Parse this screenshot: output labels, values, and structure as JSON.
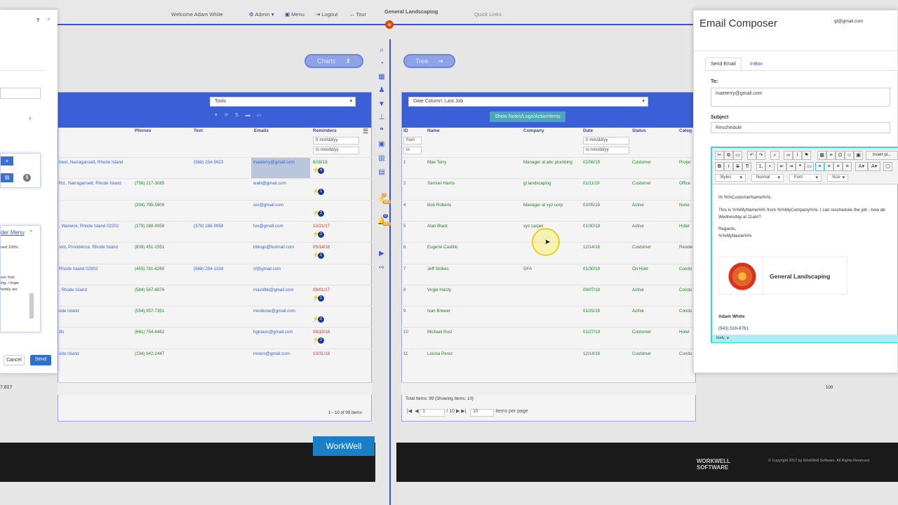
{
  "topbar": {
    "welcome": "Welcome  Adam White",
    "admin": "Admin",
    "menu": "Menu",
    "logout": "Logout",
    "tour": "Tour",
    "brand": "General Landscaping",
    "quick_links": "Quick Links"
  },
  "nav": {
    "charts": "Charts",
    "tree": "Tree"
  },
  "left_dialog": {
    "help": "?",
    "close": "×",
    "help2": "?",
    "plus": "+",
    "dollar": "$",
    "header_menu": "der Menu",
    "text_lines": [
      "ned 100%",
      "",
      "",
      "om York",
      "ing. I hope",
      "family are"
    ],
    "cancel": "Cancel",
    "send": "Send",
    "footer_num": "7,817"
  },
  "left_grid": {
    "tools": "Tools",
    "columns": [
      "Phones",
      "Text",
      "Emails",
      "Reminders"
    ],
    "filter_from": "fr mm/dd/yy",
    "filter_to": "to mm/dd/yy",
    "rows": [
      {
        "addr": "treet, Narragansett, Rhode Island",
        "phone": "",
        "text": "(568) 254-5623",
        "email": "maeterry@gmail.com",
        "rem": "6/28/19",
        "rem_color": "green",
        "badge": "4"
      },
      {
        "addr": "Rd., Narragansett, Rhode Island",
        "phone": "(756) 217-3085",
        "text": "",
        "email": "walit@gmail.com",
        "rem": "",
        "rem_color": "",
        "badge": "1"
      },
      {
        "addr": "",
        "phone": "(294) 795-5909",
        "text": "",
        "email": "ser@gmail.com",
        "rem": "",
        "rem_color": "",
        "badge": "2"
      },
      {
        "addr": ", Warwick, Rhode Island 02202",
        "phone": "(379) 288-9958",
        "text": "(379) 288-9958",
        "email": "fuv@gmail.com",
        "rem": "10/21/17",
        "rem_color": "red",
        "badge": "2"
      },
      {
        "addr": "stol, Providence, Rhode Island",
        "phone": "(839) 451-1551",
        "text": "",
        "email": "bbingo@hotmail.com",
        "rem": "05/14/18",
        "rem_color": "red",
        "badge": "1"
      },
      {
        "addr": "Rhode Island 02903",
        "phone": "(455) 781-6260",
        "text": "(568) 254-1234",
        "email": "cf@gmail.com",
        "rem": "",
        "rem_color": "",
        "badge": ""
      },
      {
        "addr": ", Rhode Island",
        "phone": "(584) 567-6876",
        "text": "",
        "email": "mavolbit@gmail.com",
        "rem": "09/01/17",
        "rem_color": "red",
        "badge": "1"
      },
      {
        "addr": "ode Island",
        "phone": "(554) 957-7351",
        "text": "",
        "email": "mesbone@gmail.com",
        "rem": "",
        "rem_color": "",
        "badge": "2"
      },
      {
        "addr": "ills",
        "phone": "(661) 754-8462",
        "text": "",
        "email": "bgmaec@gmail.com",
        "rem": "09/10/18",
        "rem_color": "red",
        "badge": "2"
      },
      {
        "addr": "ode Island",
        "phone": "(234) 642-2447",
        "text": "",
        "email": "moero@gmail.com",
        "rem": "10/31/18",
        "rem_color": "red",
        "badge": ""
      }
    ],
    "pager": "1 - 10 of 99 items"
  },
  "right_grid": {
    "date_column": "Date Column: Last Job",
    "show_notes": "Show Notes/Logs/ActionItems",
    "columns": [
      "ID",
      "Name",
      "Company",
      "Date",
      "Status",
      "Categ"
    ],
    "filter_from": "from",
    "filter_to": "to",
    "date_from": "fr mm/dd/yy",
    "date_to": "to mm/dd/yy",
    "rows": [
      {
        "id": "1",
        "name": "Mae Terry",
        "company": "Manager at abc plumbing",
        "date": "02/06/19",
        "status": "Customer",
        "cat": "Prope"
      },
      {
        "id": "2",
        "name": "Samuel Harris",
        "company": "gl landscaping",
        "date": "01/11/19",
        "status": "Customer",
        "cat": "Office"
      },
      {
        "id": "4",
        "name": "Bob Roberts",
        "company": "Manager at xyz corp",
        "date": "02/05/19",
        "status": "Active",
        "cat": "None"
      },
      {
        "id": "5",
        "name": "Alan Black",
        "company": "xyz carpet",
        "date": "01/30/19",
        "status": "Active",
        "cat": "Hotel"
      },
      {
        "id": "6",
        "name": "Eugene Castillo",
        "company": "",
        "date": "12/14/18",
        "status": "Customer",
        "cat": "Reside"
      },
      {
        "id": "7",
        "name": "Jeff Stokes",
        "company": "GFA",
        "date": "01/30/19",
        "status": "On Hold",
        "cat": "Condo"
      },
      {
        "id": "8",
        "name": "Virgie Hardy",
        "company": "",
        "date": "09/07/18",
        "status": "Active",
        "cat": "Condo"
      },
      {
        "id": "9",
        "name": "Ivan Brewer",
        "company": "",
        "date": "01/25/19",
        "status": "Active",
        "cat": "Condo"
      },
      {
        "id": "10",
        "name": "Michael Ruiz",
        "company": "",
        "date": "01/27/19",
        "status": "Customer",
        "cat": "Hotel"
      },
      {
        "id": "11",
        "name": "Louisa Perez",
        "company": "",
        "date": "12/14/18",
        "status": "Customer",
        "cat": "Condo"
      }
    ],
    "footer_num": "109",
    "total": "Total Items: 99 (Showing Items: 10)",
    "page": "1",
    "of_pages": "/ 10",
    "per_page": "10",
    "per_page_label": "items per page"
  },
  "sidebar_badges": {
    "a": "2",
    "b": "163",
    "c": "0",
    "d": "261"
  },
  "email_composer": {
    "title": "Email Composer",
    "account": "gl@gmail.com",
    "tab_send": "Send Email",
    "tab_inbox": "InBox",
    "to_label": "To:",
    "to_value": "maeterry@gmail.com",
    "subject_label": "Subject",
    "subject_value": "Reschedule",
    "insert_placeholder": "Insert pl...",
    "styles": "Styles",
    "normal": "Normal",
    "font": "Font",
    "size": "Size",
    "body_hi": "Hi %%CustomerName%%,",
    "body_line1": "This is %%MyName%% from %%MyCompany%%. I can reschedule the job - how ab",
    "body_line2": "Wednesday at 11am?",
    "body_regards": "Regards,",
    "body_name": "%%MyName%%",
    "sig_company": "General Landscaping",
    "sig_name": "Adam White",
    "sig_phone": "(543) 516-8761",
    "status_body": "body",
    "status_p": "p"
  },
  "footer": {
    "workwell": "WorkWell",
    "software1": "WORKWELL",
    "software2": "SOFTWARE",
    "copyright": "© Copyright 2017 by WorkWell Software. All Rights Reserved."
  }
}
